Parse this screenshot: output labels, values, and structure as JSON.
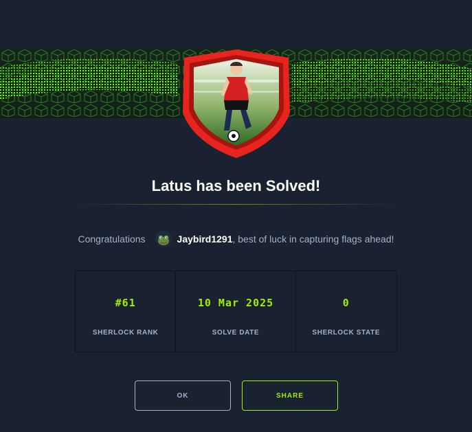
{
  "modal": {
    "title": "Latus has been Solved!",
    "congrats_prefix": "Congratulations",
    "username": "Jaybird1291",
    "congrats_suffix": ", best of luck in capturing flags ahead!"
  },
  "stats": [
    {
      "value": "#61",
      "label": "SHERLOCK RANK"
    },
    {
      "value": "10 Mar 2025",
      "label": "SOLVE DATE"
    },
    {
      "value": "0",
      "label": "SHERLOCK STATE"
    }
  ],
  "buttons": {
    "ok": "OK",
    "share": "SHARE"
  },
  "icons": {
    "banner": "green-cube-wave-banner",
    "badge": "football-player-shield-badge",
    "avatar": "frog-avatar"
  },
  "colors": {
    "background": "#1a2231",
    "accent": "#9fef00",
    "muted": "#a4b1cd",
    "badge_red": "#e8241f"
  }
}
